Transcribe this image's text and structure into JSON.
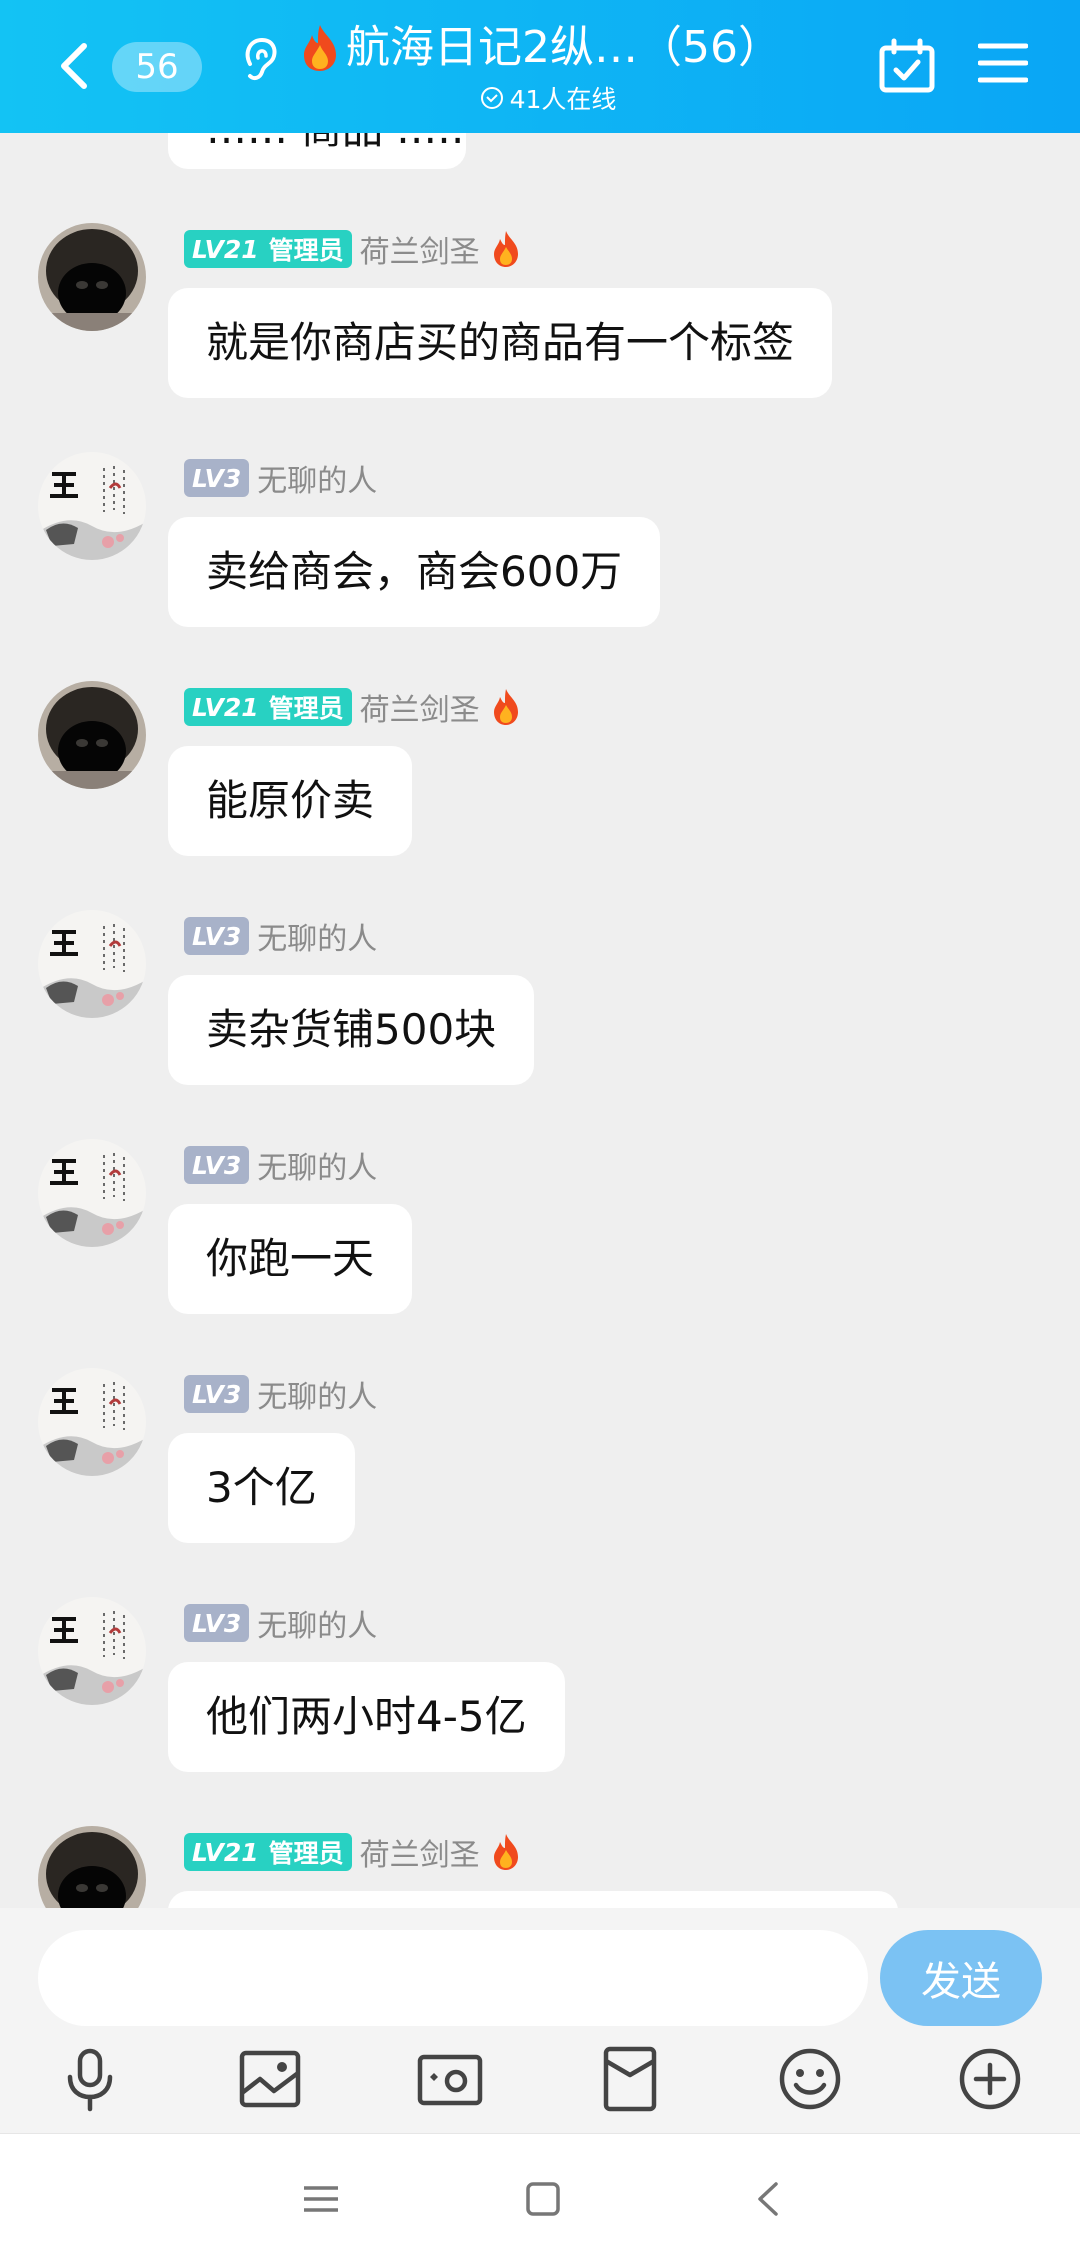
{
  "header": {
    "unread_count": "56",
    "title": "航海日记2纵…（56）",
    "online_text": "41人在线",
    "gradient": [
      "#13c3f4",
      "#0aa6f5"
    ]
  },
  "partial_message": {
    "text": "…… 商品 ……"
  },
  "messages": [
    {
      "avatar": "black-dog-avatar",
      "role": "admin",
      "level": "LV21",
      "role_label": "管理员",
      "name": "荷兰剑圣",
      "fire": true,
      "text": "就是你商店买的商品有一个标签"
    },
    {
      "avatar": "calligraphy-avatar",
      "role": "member",
      "level": "LV3",
      "role_label": "",
      "name": "无聊的人",
      "fire": false,
      "text": "卖给商会，商会600万"
    },
    {
      "avatar": "black-dog-avatar",
      "role": "admin",
      "level": "LV21",
      "role_label": "管理员",
      "name": "荷兰剑圣",
      "fire": true,
      "text": "能原价卖"
    },
    {
      "avatar": "calligraphy-avatar",
      "role": "member",
      "level": "LV3",
      "role_label": "",
      "name": "无聊的人",
      "fire": false,
      "text": "卖杂货铺500块"
    },
    {
      "avatar": "calligraphy-avatar",
      "role": "member",
      "level": "LV3",
      "role_label": "",
      "name": "无聊的人",
      "fire": false,
      "text": "你跑一天"
    },
    {
      "avatar": "calligraphy-avatar",
      "role": "member",
      "level": "LV3",
      "role_label": "",
      "name": "无聊的人",
      "fire": false,
      "text": "3个亿"
    },
    {
      "avatar": "calligraphy-avatar",
      "role": "member",
      "level": "LV3",
      "role_label": "",
      "name": "无聊的人",
      "fire": false,
      "text": "他们两小时4-5亿"
    },
    {
      "avatar": "black-dog-avatar",
      "role": "admin",
      "level": "LV21",
      "role_label": "管理员",
      "name": "荷兰剑圣",
      "fire": true,
      "text": ""
    }
  ],
  "input": {
    "placeholder": "",
    "send_label": "发送"
  },
  "toolbar": [
    "microphone-icon",
    "picture-icon",
    "camera-icon",
    "red-packet-icon",
    "emoji-icon",
    "plus-icon"
  ],
  "navbar": [
    "menu-icon",
    "home-square-icon",
    "back-icon"
  ],
  "colors": {
    "admin_badge": "#28d1c2",
    "level_badge": "#a8b2c9",
    "send_button": "#7bc2f3",
    "chat_bg": "#efefef"
  }
}
